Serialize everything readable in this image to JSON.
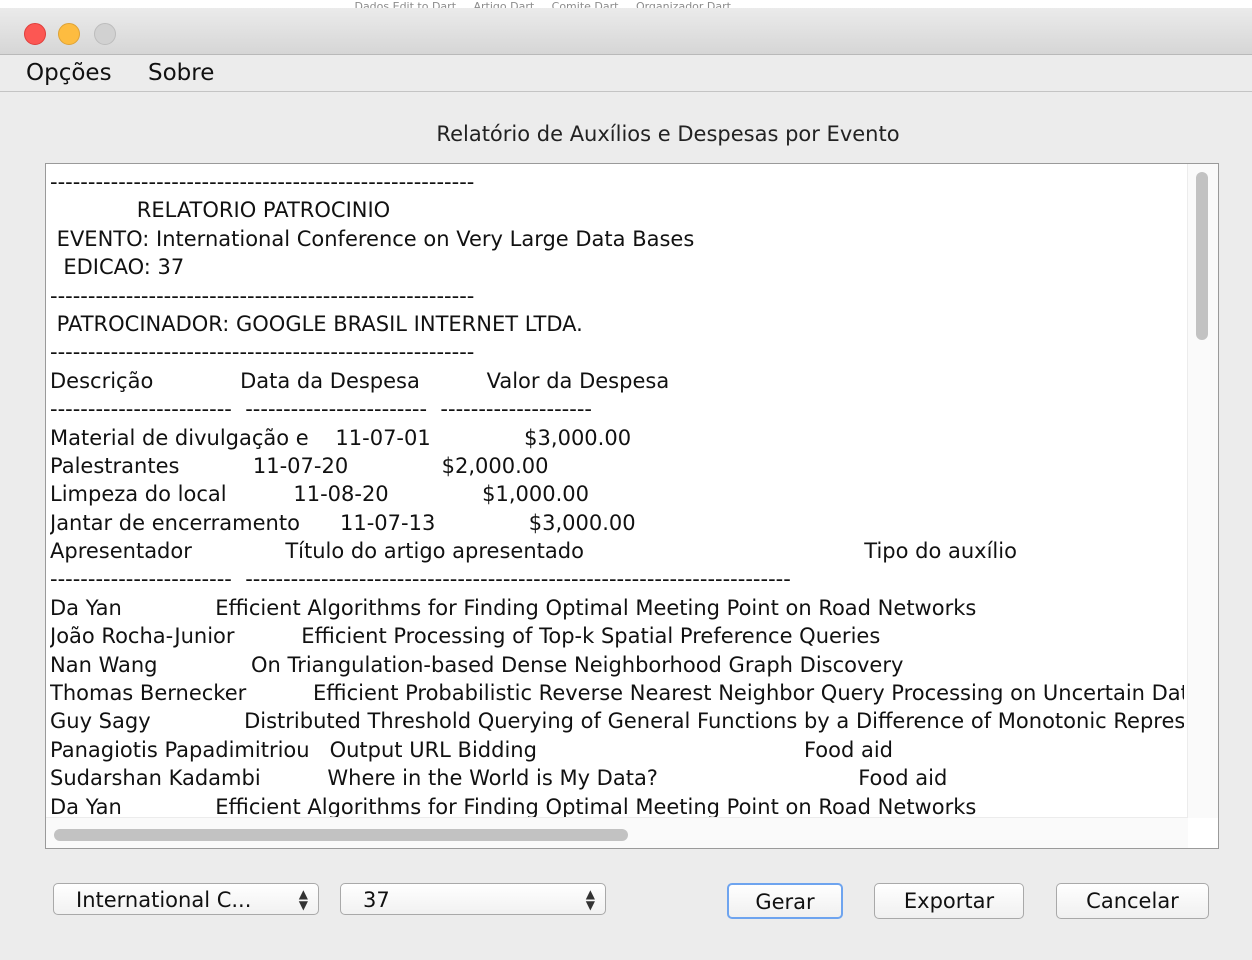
{
  "background_window": {
    "strip_text": "......  Dados    Edit to Dart ...  Artigo Dart ...  Comite Dart ...  Organizador Dart ..."
  },
  "menu": {
    "items": [
      "Opções",
      "Sobre"
    ]
  },
  "report": {
    "title": "Relatório de Auxílios e Despesas por Evento",
    "lines": [
      "--------------------------------------------------------",
      "             RELATORIO PATROCINIO",
      " EVENTO: International Conference on Very Large Data Bases",
      "  EDICAO: 37",
      "--------------------------------------------------------",
      " PATROCINADOR: GOOGLE BRASIL INTERNET LTDA.",
      "--------------------------------------------------------",
      "Descrição             Data da Despesa          Valor da Despesa",
      "------------------------  ------------------------  --------------------",
      "Material de divulgação e    11-07-01              $3,000.00",
      "Palestrantes           11-07-20              $2,000.00",
      "Limpeza do local          11-08-20              $1,000.00",
      "Jantar de encerramento      11-07-13              $3,000.00",
      "Apresentador              Título do artigo apresentado                                          Tipo do auxílio",
      "------------------------  ------------------------------------------------------------------------",
      "Da Yan              Efficient Algorithms for Finding Optimal Meeting Point on Road Networks",
      "João Rocha-Junior          Efficient Processing of Top-k Spatial Preference Queries",
      "Nan Wang              On Triangulation-based Dense Neighborhood Graph Discovery",
      "Thomas Bernecker          Efficient Probabilistic Reverse Nearest Neighbor Query Processing on Uncertain Data",
      "Guy Sagy              Distributed Threshold Querying of General Functions by a Difference of Monotonic Representation",
      "Panagiotis Papadimitriou   Output URL Bidding                                        Food aid",
      "Sudarshan Kadambi          Where in the World is My Data?                              Food aid",
      "Da Yan              Efficient Algorithms for Finding Optimal Meeting Point on Road Networks"
    ]
  },
  "controls": {
    "event_select": "International C...",
    "edition_select": "37",
    "generate_button": "Gerar",
    "export_button": "Exportar",
    "cancel_button": "Cancelar"
  }
}
